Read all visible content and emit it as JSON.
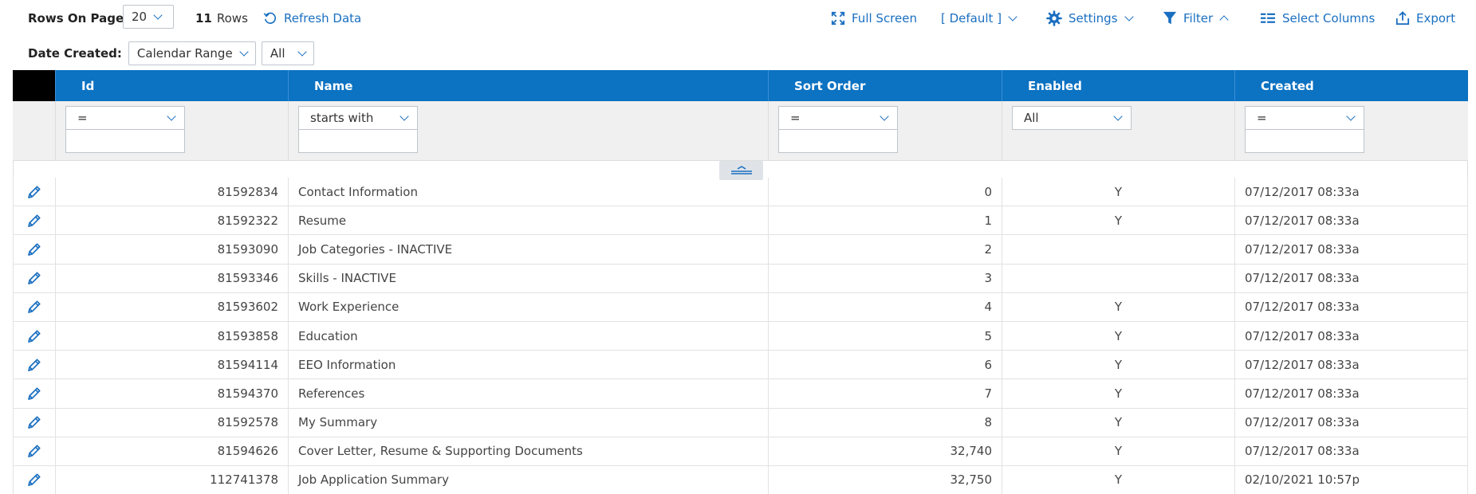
{
  "toolbar": {
    "rows_on_page_label": "Rows On Page",
    "rows_on_page_value": "20",
    "row_count": "11",
    "rows_label": "Rows",
    "refresh_label": "Refresh Data",
    "full_screen_label": "Full Screen",
    "view_label": "[ Default ]",
    "settings_label": "Settings",
    "filter_label": "Filter",
    "select_columns_label": "Select Columns",
    "export_label": "Export"
  },
  "date_filter": {
    "label": "Date Created:",
    "range_value": "Calendar Range",
    "all_value": "All"
  },
  "columns": [
    "Id",
    "Name",
    "Sort Order",
    "Enabled",
    "Created"
  ],
  "filters": {
    "id_operator": "=",
    "name_operator": "starts with",
    "sort_operator": "=",
    "enabled_value": "All",
    "created_operator": "="
  },
  "rows": [
    {
      "id": "81592834",
      "name": "Contact Information",
      "sort": "0",
      "enabled": "Y",
      "created": "07/12/2017 08:33a"
    },
    {
      "id": "81592322",
      "name": "Resume",
      "sort": "1",
      "enabled": "Y",
      "created": "07/12/2017 08:33a"
    },
    {
      "id": "81593090",
      "name": "Job Categories - INACTIVE",
      "sort": "2",
      "enabled": "",
      "created": "07/12/2017 08:33a"
    },
    {
      "id": "81593346",
      "name": "Skills - INACTIVE",
      "sort": "3",
      "enabled": "",
      "created": "07/12/2017 08:33a"
    },
    {
      "id": "81593602",
      "name": "Work Experience",
      "sort": "4",
      "enabled": "Y",
      "created": "07/12/2017 08:33a"
    },
    {
      "id": "81593858",
      "name": "Education",
      "sort": "5",
      "enabled": "Y",
      "created": "07/12/2017 08:33a"
    },
    {
      "id": "81594114",
      "name": "EEO Information",
      "sort": "6",
      "enabled": "Y",
      "created": "07/12/2017 08:33a"
    },
    {
      "id": "81594370",
      "name": "References",
      "sort": "7",
      "enabled": "Y",
      "created": "07/12/2017 08:33a"
    },
    {
      "id": "81592578",
      "name": "My Summary",
      "sort": "8",
      "enabled": "Y",
      "created": "07/12/2017 08:33a"
    },
    {
      "id": "81594626",
      "name": "Cover Letter, Resume & Supporting Documents",
      "sort": "32,740",
      "enabled": "Y",
      "created": "07/12/2017 08:33a"
    },
    {
      "id": "112741378",
      "name": "Job Application Summary",
      "sort": "32,750",
      "enabled": "Y",
      "created": "02/10/2021 10:57p"
    }
  ],
  "colors": {
    "header_bg": "#0c72c2",
    "link": "#1a6fc0",
    "filter_bg": "#f0f0f0"
  },
  "icons": {
    "refresh": "refresh-icon",
    "full_screen": "expand-icon",
    "settings": "gear-icon",
    "filter": "funnel-icon",
    "select_columns": "columns-icon",
    "export": "export-icon",
    "edit": "pencil-icon",
    "collapse": "collapse-icon"
  }
}
